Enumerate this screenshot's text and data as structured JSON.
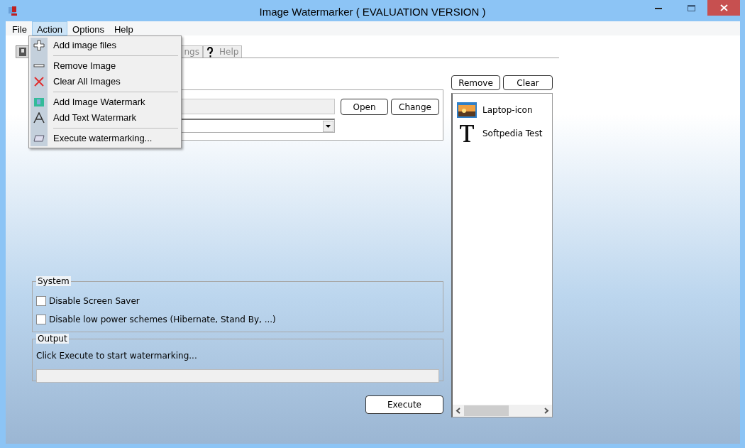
{
  "window": {
    "title": "Image Watermarker ( EVALUATION VERSION )"
  },
  "menubar": [
    {
      "label": "File",
      "selected": false
    },
    {
      "label": "Action",
      "selected": true
    },
    {
      "label": "Options",
      "selected": false
    },
    {
      "label": "Help",
      "selected": false
    }
  ],
  "action_menu": [
    {
      "kind": "item",
      "label": "Add image files"
    },
    {
      "kind": "separator"
    },
    {
      "kind": "item",
      "label": "Remove Image"
    },
    {
      "kind": "item",
      "label": "Clear All Images"
    },
    {
      "kind": "separator"
    },
    {
      "kind": "item",
      "label": "Add Image Watermark"
    },
    {
      "kind": "item",
      "label": "Add Text Watermark"
    },
    {
      "kind": "separator"
    },
    {
      "kind": "item",
      "label": "Execute watermarking..."
    }
  ],
  "tabs": [
    {
      "selected": true
    },
    {
      "label": "ngs",
      "selected": false
    },
    {
      "label": "Help",
      "selected": false
    }
  ],
  "source": {
    "buttons": [
      "Open",
      "Change"
    ]
  },
  "system": {
    "title": "System",
    "options": [
      {
        "label": "Disable Screen Saver",
        "checked": false
      },
      {
        "label": "Disable low power schemes (Hibernate, Stand By, ...)",
        "checked": false
      }
    ]
  },
  "output": {
    "title": "Output",
    "message": "Click Execute to start watermarking...",
    "level": 0
  },
  "execute_button": "Execute",
  "watermark_buttons": [
    "Remove",
    "Clear"
  ],
  "watermarks": [
    {
      "kind": "image",
      "label": "Laptop-icon"
    },
    {
      "kind": "text",
      "label": "Softpedia Test"
    }
  ]
}
